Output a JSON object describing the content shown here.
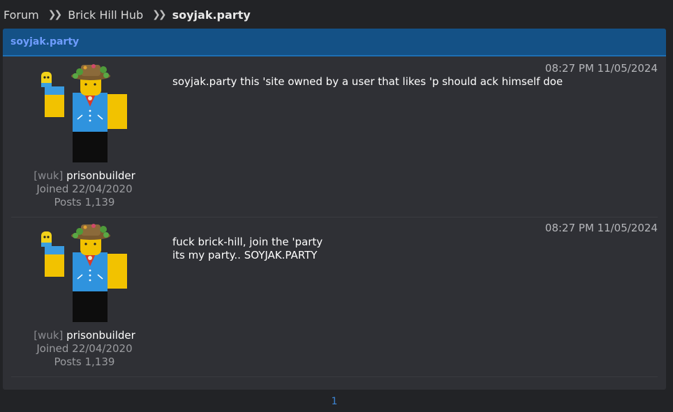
{
  "breadcrumb": {
    "items": [
      "Forum",
      "Brick Hill Hub",
      "soyjak.party"
    ]
  },
  "thread": {
    "title": "soyjak.party"
  },
  "posts": [
    {
      "author": {
        "prefix": "[wuk]",
        "username": "prisonbuilder",
        "joined": "Joined 22/04/2020",
        "posts": "Posts 1,139"
      },
      "timestamp": "08:27 PM 11/05/2024",
      "lines": [
        "soyjak.party this 'site owned by a user that likes 'p should ack himself doe"
      ]
    },
    {
      "author": {
        "prefix": "[wuk]",
        "username": "prisonbuilder",
        "joined": "Joined 22/04/2020",
        "posts": "Posts 1,139"
      },
      "timestamp": "08:27 PM 11/05/2024",
      "lines": [
        "fuck brick-hill, join the 'party",
        "its my party.. SOYJAK.PARTY"
      ]
    }
  ],
  "pagination": {
    "current": "1"
  },
  "colors": {
    "header_bg": "#145186",
    "header_text": "#6f9dff",
    "page_link": "#3d86d6"
  }
}
